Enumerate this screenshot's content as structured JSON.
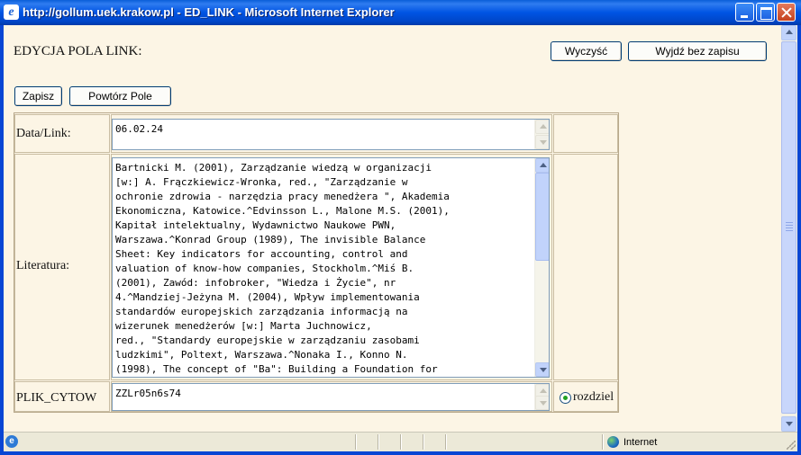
{
  "window": {
    "title": "http://gollum.uek.krakow.pl - ED_LINK - Microsoft Internet Explorer",
    "icon": "ie-icon"
  },
  "page": {
    "heading": "EDYCJA POLA LINK:",
    "top_buttons": {
      "clear": "Wyczyść",
      "exit": "Wyjdź bez zapisu"
    },
    "action_buttons": {
      "save": "Zapisz",
      "repeat": "Powtórz Pole"
    }
  },
  "form": {
    "date_link": {
      "label": "Data/Link:",
      "value": "06.02.24"
    },
    "literatura": {
      "label": "Literatura:",
      "lines": [
        "Bartnicki M. (2001), Zarządzanie wiedzą w organizacji",
        "[w:] A. Frączkiewicz-Wronka, red., \"Zarządzanie w",
        "ochronie zdrowia - narzędzia pracy menedżera \", Akademia",
        "Ekonomiczna, Katowice.^Edvinsson L., Malone M.S. (2001),",
        "Kapitał intelektualny, Wydawnictwo Naukowe PWN,",
        "Warszawa.^Konrad Group (1989), The invisible Balance",
        "Sheet: Key indicators for accounting, control and",
        "valuation of know-how companies, Stockholm.^Miś B.",
        "(2001), Zawód: infobroker, \"Wiedza i Życie\", nr",
        "4.^Mandziej-Jeżyna M. (2004), Wpływ implementowania",
        "standardów europejskich zarządzania informacją na",
        "wizerunek menedżerów [w:] Marta Juchnowicz,",
        "red., \"Standardy europejskie w zarządzaniu zasobami",
        "ludzkimi\", Poltext, Warszawa.^Nonaka I., Konno N.",
        "(1998), The concept of \"Ba\": Building a Foundation for"
      ]
    },
    "plik_cytow": {
      "label": "PLIK_CYTOW",
      "value": "ZZLr05n6s74",
      "radio_label": "rozdziel"
    }
  },
  "status": {
    "zone": "Internet"
  }
}
